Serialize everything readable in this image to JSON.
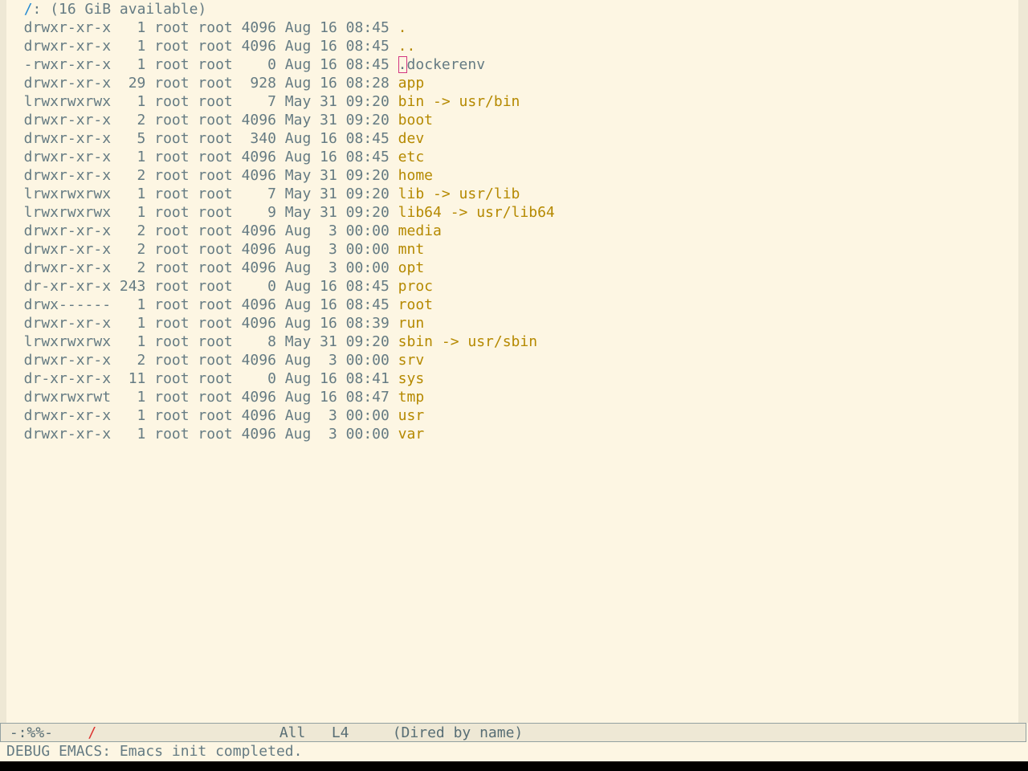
{
  "header": {
    "indent": "  ",
    "dir": "/",
    "rest": ": (16 GiB available)"
  },
  "entries": [
    {
      "meta": "  drwxr-xr-x   1 root root 4096 Aug 16 08:45 ",
      "name": ".",
      "kind": "dir"
    },
    {
      "meta": "  drwxr-xr-x   1 root root 4096 Aug 16 08:45 ",
      "name": "..",
      "kind": "dir"
    },
    {
      "meta": "  -rwxr-xr-x   1 root root    0 Aug 16 08:45 ",
      "name": "dockerenv",
      "cursor_char": ".",
      "kind": "file",
      "cursor": true
    },
    {
      "meta": "  drwxr-xr-x  29 root root  928 Aug 16 08:28 ",
      "name": "app",
      "kind": "dir"
    },
    {
      "meta": "  lrwxrwxrwx   1 root root    7 May 31 09:20 ",
      "name": "bin -> usr/bin",
      "kind": "link"
    },
    {
      "meta": "  drwxr-xr-x   2 root root 4096 May 31 09:20 ",
      "name": "boot",
      "kind": "dir"
    },
    {
      "meta": "  drwxr-xr-x   5 root root  340 Aug 16 08:45 ",
      "name": "dev",
      "kind": "dir"
    },
    {
      "meta": "  drwxr-xr-x   1 root root 4096 Aug 16 08:45 ",
      "name": "etc",
      "kind": "dir"
    },
    {
      "meta": "  drwxr-xr-x   2 root root 4096 May 31 09:20 ",
      "name": "home",
      "kind": "dir"
    },
    {
      "meta": "  lrwxrwxrwx   1 root root    7 May 31 09:20 ",
      "name": "lib -> usr/lib",
      "kind": "link"
    },
    {
      "meta": "  lrwxrwxrwx   1 root root    9 May 31 09:20 ",
      "name": "lib64 -> usr/lib64",
      "kind": "link"
    },
    {
      "meta": "  drwxr-xr-x   2 root root 4096 Aug  3 00:00 ",
      "name": "media",
      "kind": "dir"
    },
    {
      "meta": "  drwxr-xr-x   2 root root 4096 Aug  3 00:00 ",
      "name": "mnt",
      "kind": "dir"
    },
    {
      "meta": "  drwxr-xr-x   2 root root 4096 Aug  3 00:00 ",
      "name": "opt",
      "kind": "dir"
    },
    {
      "meta": "  dr-xr-xr-x 243 root root    0 Aug 16 08:45 ",
      "name": "proc",
      "kind": "dir"
    },
    {
      "meta": "  drwx------   1 root root 4096 Aug 16 08:45 ",
      "name": "root",
      "kind": "dir"
    },
    {
      "meta": "  drwxr-xr-x   1 root root 4096 Aug 16 08:39 ",
      "name": "run",
      "kind": "dir"
    },
    {
      "meta": "  lrwxrwxrwx   1 root root    8 May 31 09:20 ",
      "name": "sbin -> usr/sbin",
      "kind": "link"
    },
    {
      "meta": "  drwxr-xr-x   2 root root 4096 Aug  3 00:00 ",
      "name": "srv",
      "kind": "dir"
    },
    {
      "meta": "  dr-xr-xr-x  11 root root    0 Aug 16 08:41 ",
      "name": "sys",
      "kind": "dir"
    },
    {
      "meta": "  drwxrwxrwt   1 root root 4096 Aug 16 08:47 ",
      "name": "tmp",
      "kind": "dir"
    },
    {
      "meta": "  drwxr-xr-x   1 root root 4096 Aug  3 00:00 ",
      "name": "usr",
      "kind": "dir"
    },
    {
      "meta": "  drwxr-xr-x   1 root root 4096 Aug  3 00:00 ",
      "name": "var",
      "kind": "dir"
    }
  ],
  "modeline": {
    "status": " -:%%-  ",
    "path": "/",
    "position": "All",
    "line": "L4",
    "mode": "(Dired by name)"
  },
  "echo": {
    "message": "DEBUG EMACS: Emacs init completed."
  },
  "colors": {
    "background": "#fdf6e3",
    "directory_name": "#b58900",
    "header_dir": "#268bd2",
    "cursor": "#d33682"
  }
}
